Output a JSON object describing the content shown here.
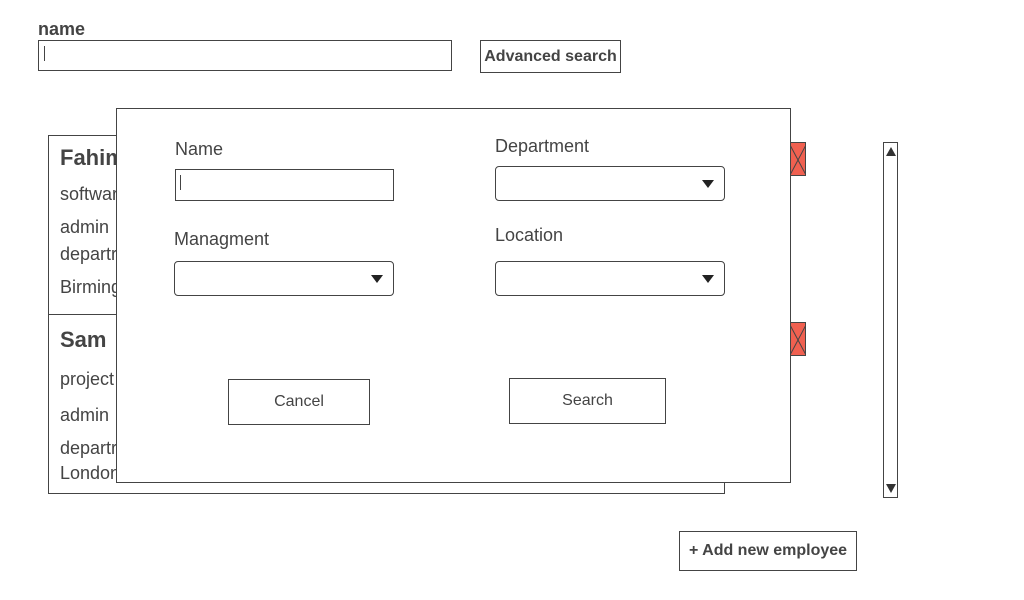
{
  "search": {
    "label": "name",
    "value": "",
    "advanced_label": "Advanced search"
  },
  "employees": [
    {
      "name": "Fahim",
      "title": "softwar",
      "role": "admin",
      "department": "departr",
      "location": "Birming"
    },
    {
      "name": "Sam",
      "title": "project",
      "role": "admin",
      "department": "departr",
      "location": "London"
    }
  ],
  "add_employee_label": "+ Add new employee",
  "colors": {
    "delete_button": "#f06050",
    "border": "#444444"
  },
  "icons": {
    "scroll_up": "triangle-up",
    "scroll_down": "triangle-down",
    "select_arrow": "triangle-down"
  },
  "modal": {
    "name_label": "Name",
    "name_value": "",
    "department_label": "Department",
    "department_value": "",
    "management_label": "Managment",
    "management_value": "",
    "location_label": "Location",
    "location_value": "",
    "cancel_label": "Cancel",
    "search_label": "Search"
  }
}
